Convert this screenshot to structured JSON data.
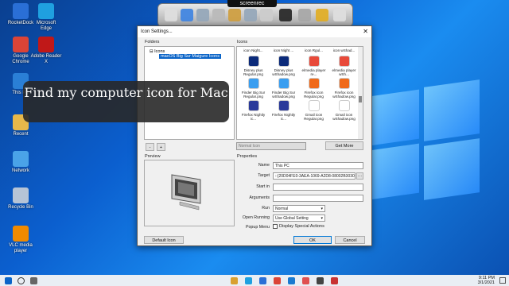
{
  "desktop_icons": [
    {
      "name": "RocketDock",
      "color": "#2a6fd6"
    },
    {
      "name": "Microsoft Edge",
      "color": "#1fa0e0"
    },
    {
      "name": "Google Chrome",
      "color": "#db4437"
    },
    {
      "name": "Adobe Reader X",
      "color": "#c01818"
    },
    {
      "name": "This PC",
      "color": "#2a7fd6"
    },
    {
      "name": "Recent",
      "color": "#e7b84a"
    },
    {
      "name": "Network",
      "color": "#4aa3e8"
    },
    {
      "name": "Recycle Bin",
      "color": "#b6c4d6"
    },
    {
      "name": "VLC media player",
      "color": "#f08a00"
    }
  ],
  "dock": {
    "logo_text": "screenrec"
  },
  "dialog": {
    "title": "Icon Settings...",
    "folders_label": "Folders",
    "icons_label": "Icons",
    "tree_root": "Icons",
    "tree_selected": "macOS Big Sur Maigure Icons",
    "add_label": "+",
    "remove_label": "-",
    "icon_grid": [
      {
        "label": "icon Night...",
        "color": "#ffffff"
      },
      {
        "label": "icon Night ...",
        "color": "#ffffff"
      },
      {
        "label": "icon Rgul...",
        "color": "#ffffff"
      },
      {
        "label": "icon wShad...",
        "color": "#ffffff"
      },
      {
        "label": "Disney plus Regular.png",
        "color": "#0b2a7a"
      },
      {
        "label": "Disney plus wShadow.png",
        "color": "#0b2a7a"
      },
      {
        "label": "elmedia player re...",
        "color": "#e84a3a"
      },
      {
        "label": "elmedia player wSh...",
        "color": "#e84a3a"
      },
      {
        "label": "Finder Big Sur Regular.png",
        "color": "#3a9ef0"
      },
      {
        "label": "Finder Big Sur wShadow.png",
        "color": "#3a9ef0"
      },
      {
        "label": "Firefox icon Regular.png",
        "color": "#f06a1a"
      },
      {
        "label": "Firefox icon wShadow.png",
        "color": "#f06a1a"
      },
      {
        "label": "Firefox Nightly ic...",
        "color": "#2a3a9a"
      },
      {
        "label": "Firefox Nightly ic...",
        "color": "#2a3a9a"
      },
      {
        "label": "Gmail icon Regular.png",
        "color": "#ffffff"
      },
      {
        "label": "Gmail icon wShadow.png",
        "color": "#ffffff"
      }
    ],
    "normal_icon_placeholder": "Normal Icon",
    "get_more": "Get More",
    "preview_label": "Preview",
    "properties_label": "Properties",
    "props": {
      "name_label": "Name",
      "name_value": "This PC",
      "target_label": "Target",
      "target_value": "::{20D04FE0-3AEA-1069-A2D8-08002B30309D}",
      "startin_label": "Start in",
      "startin_value": "",
      "args_label": "Arguments",
      "args_value": "",
      "run_label": "Run",
      "run_value": "Normal",
      "open_running_label": "Open Running",
      "open_running_value": "Use Global Setting",
      "popup_label": "Popup Menu",
      "popup_check": "Display Special Actions"
    },
    "default_icon": "Default Icon",
    "ok": "OK",
    "cancel": "Cancel"
  },
  "caption": "Find my computer icon for Mac",
  "taskbar": {
    "time": "9:11 PM",
    "date": "3/1/2021"
  }
}
